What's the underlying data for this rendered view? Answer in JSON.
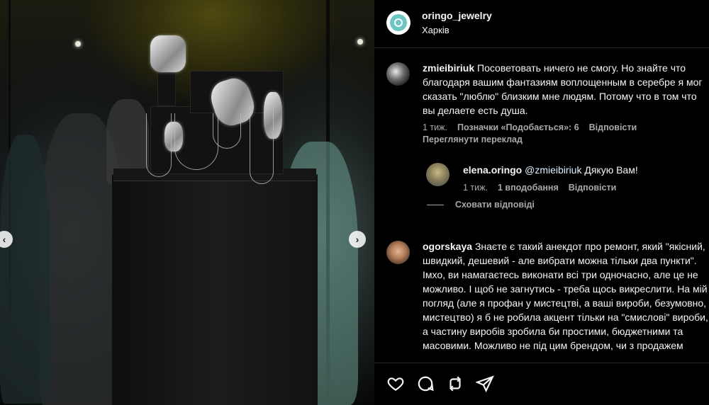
{
  "post": {
    "image_alt": "Silver jewelry display on black pedestal in museum showcase"
  },
  "header": {
    "username": "oringo_jewelry",
    "location": "Харків"
  },
  "comments": [
    {
      "username": "zmieibiriuk",
      "text": "Посоветовать ничего не смогу. Но знайте что благодаря вашим фантазиям воплощенным в серебре я мог сказать \"люблю\" близким мне людям. Потому что в том что вы делаете есть душа.",
      "time": "1 тиж.",
      "likes": "Позначки «Подобається»: 6",
      "reply_label": "Відповісти",
      "translate_label": "Переглянути переклад"
    },
    {
      "username": "elena.oringo",
      "mention": "@zmieibiriuk",
      "text": "Дякую Вам!",
      "time": "1 тиж.",
      "likes": "1 вподобання",
      "reply_label": "Відповісти"
    },
    {
      "username": "ogorskaya",
      "text": "Знаєте є такий анекдот про ремонт, який \"якісний, швидкий, дешевий - але вибрати можна тільки два пункти\". Імхо, ви намагаєтесь виконати всі три одночасно, але це не можливо. І щоб не загнутись - треба щось викреслити. На мій погляд (але я профан у мистецтві, а ваші вироби, безумовно, мистецтво) я б не робила акцент тільки на \"смислові\" вироби, а частину виробів зробила би простими, бюджетними та масовими. Можливо не під цим брендом, чи з продажем"
    }
  ],
  "hide_replies_label": "Сховати відповіді",
  "colors": {
    "background": "#000000",
    "text": "#f5f5f5",
    "secondary_text": "#a8a8a8",
    "mention": "#e0f1ff",
    "logo_accent": "#6dc7c0"
  },
  "icons": [
    "heart-icon",
    "comment-icon",
    "repost-icon",
    "share-icon",
    "chevron-left-icon",
    "chevron-right-icon"
  ]
}
